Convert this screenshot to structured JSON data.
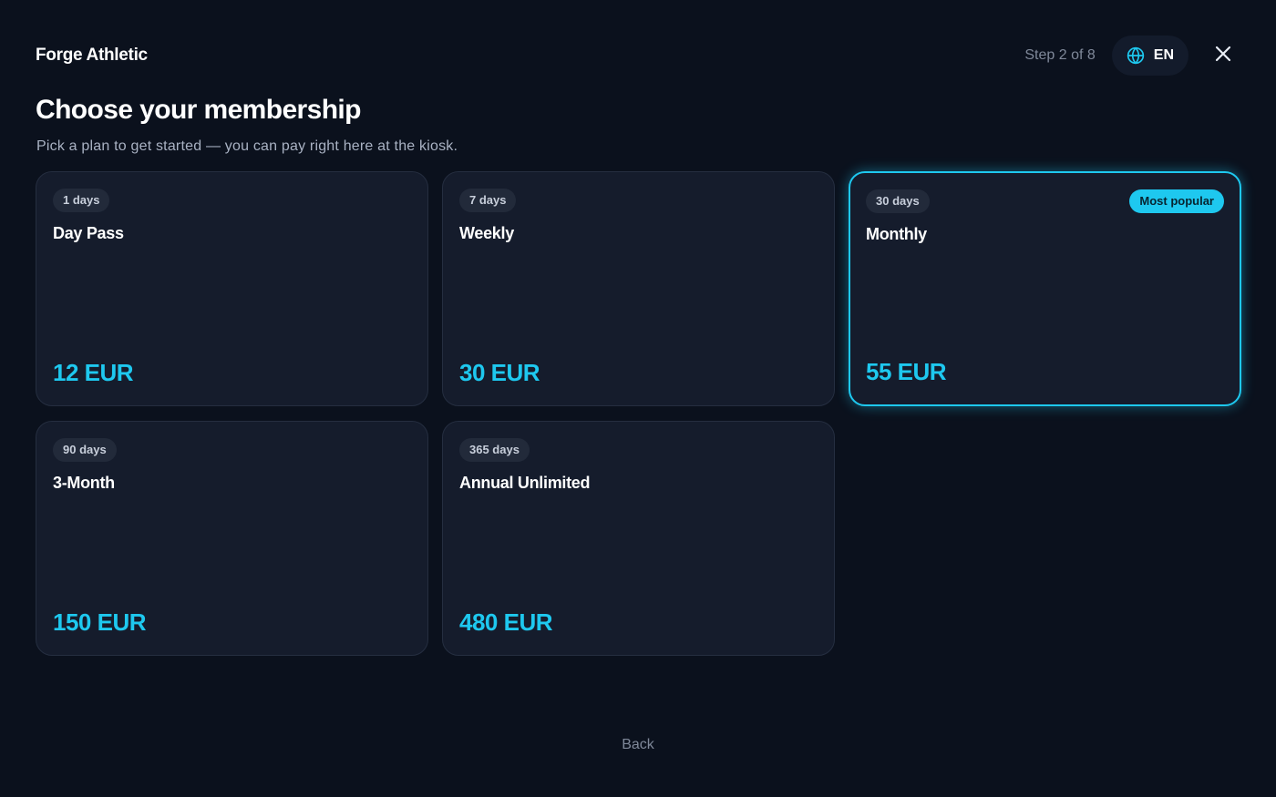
{
  "header": {
    "brand": "Forge Athletic",
    "step": "Step 2 of 8",
    "language": "EN",
    "globe_icon": "globe-icon",
    "close_icon": "close-icon"
  },
  "main": {
    "title": "Choose your membership",
    "subtitle": "Pick a plan to get started — you can pay right here at the kiosk.",
    "plans": [
      {
        "duration": "1 days",
        "name": "Day Pass",
        "price": "12 EUR",
        "selected": false
      },
      {
        "duration": "7 days",
        "name": "Weekly",
        "price": "30 EUR",
        "selected": false
      },
      {
        "duration": "30 days",
        "name": "Monthly",
        "price": "55 EUR",
        "selected": true,
        "badge": "Most popular"
      },
      {
        "duration": "90 days",
        "name": "3-Month",
        "price": "150 EUR",
        "selected": false
      },
      {
        "duration": "365 days",
        "name": "Annual Unlimited",
        "price": "480 EUR",
        "selected": false
      }
    ]
  },
  "footer": {
    "back_label": "Back"
  },
  "colors": {
    "background": "#0b111d",
    "card": "#151c2c",
    "accent": "#1ec8ef",
    "muted_text": "#7f8899"
  }
}
